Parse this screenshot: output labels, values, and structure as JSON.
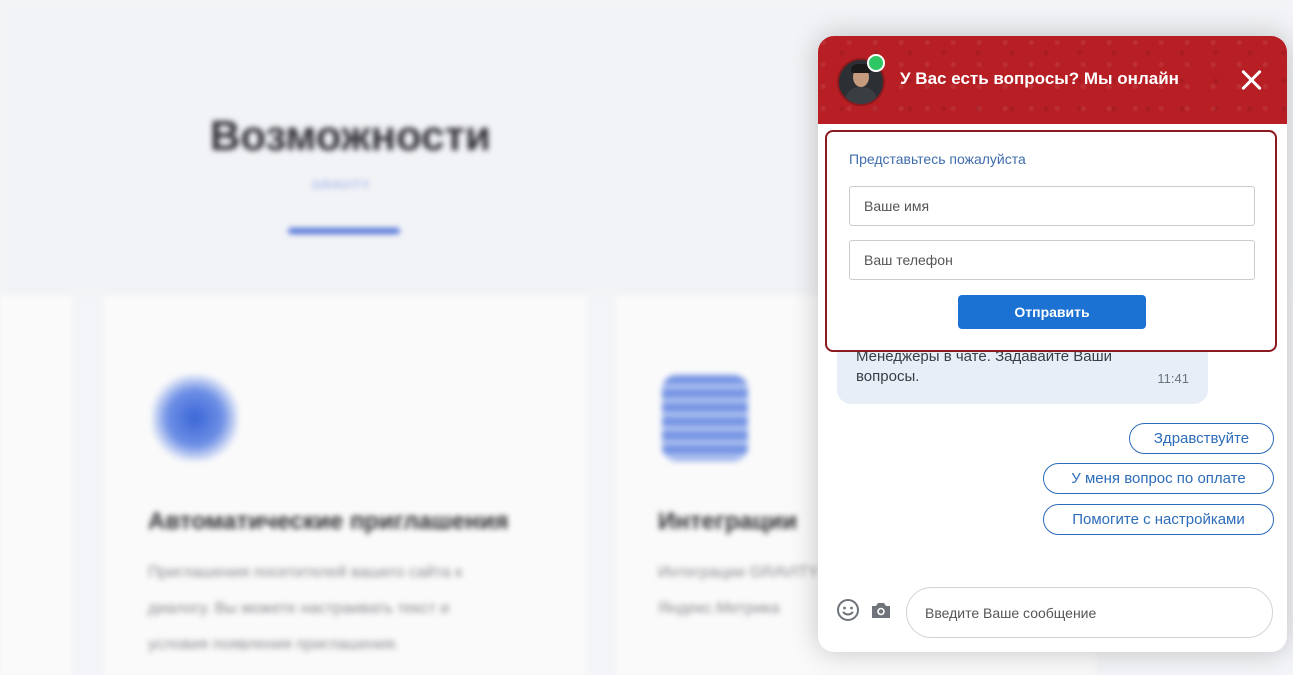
{
  "background_page": {
    "section_title": "Возможности",
    "section_subtitle": "GRAVITY",
    "cards": [
      {
        "title": "Автоматические приглашения",
        "text_lines": [
          "Приглашения посетителей вашего сайта к",
          "диалогу. Вы можете настраивать текст и",
          "условия появления приглашения."
        ]
      },
      {
        "title": "Интеграции",
        "text_lines": [
          "Интеграции GRAVITY с",
          "Яндекс.Метрика"
        ]
      }
    ]
  },
  "chat": {
    "header": {
      "title": "У Вас есть вопросы? Мы онлайн",
      "avatar_icon": "operator-avatar",
      "status": "online",
      "close_icon": "close-icon"
    },
    "colors": {
      "header": "#b71f25",
      "accent": "#1b72d2",
      "online": "#2ec764"
    },
    "intro_form": {
      "label": "Представьтесь пожалуйста",
      "name_placeholder": "Ваше имя",
      "phone_placeholder": "Ваш телефон",
      "submit_label": "Отправить"
    },
    "message": {
      "text_line1": "Менеджеры в чате. Задавайте Ваши",
      "text_line2": "вопросы.",
      "time": "11:41"
    },
    "quick_replies": [
      "Здравствуйте",
      "У меня вопрос по оплате",
      "Помогите с настройками"
    ],
    "composer": {
      "placeholder": "Введите Ваше сообщение",
      "emoji_icon": "smile-icon",
      "attach_icon": "camera-icon"
    }
  }
}
